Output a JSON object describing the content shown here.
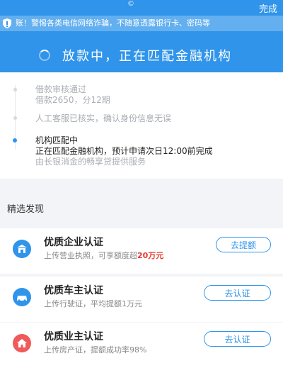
{
  "header": {
    "done_label": "完成",
    "copyright": "©",
    "notice_text": "账！警惕各类电信网络诈骗，不随意透露银行卡、密码等",
    "status_title": "放款中，正在匹配金融机构"
  },
  "progress": {
    "steps": [
      {
        "title": "借款审核通过",
        "detail": "借款2650，分12期"
      },
      {
        "title": "人工客服已核实，确认身份信息无误"
      },
      {
        "title": "机构匹配中",
        "detail": "正在匹配金融机构，预计申请次日12:00前完成",
        "note": "由长银消金的畅享贷提供服务"
      }
    ]
  },
  "discover": {
    "title": "精选发现",
    "items": [
      {
        "name": "优质企业认证",
        "desc_prefix": "上传营业执照，可享额度超",
        "desc_highlight": "20万元",
        "button": "去提额",
        "icon": "building-icon"
      },
      {
        "name": "优质车主认证",
        "desc": "上传行驶证，平均提额1万元",
        "button": "去认证",
        "icon": "car-icon"
      },
      {
        "name": "优质业主认证",
        "desc": "上传房产证，提额成功率98%",
        "button": "去认证",
        "icon": "house-icon"
      }
    ]
  },
  "colors": {
    "brand": "#2f94ea",
    "highlight": "#e33a2e",
    "icon_red": "#ef5a5a"
  }
}
